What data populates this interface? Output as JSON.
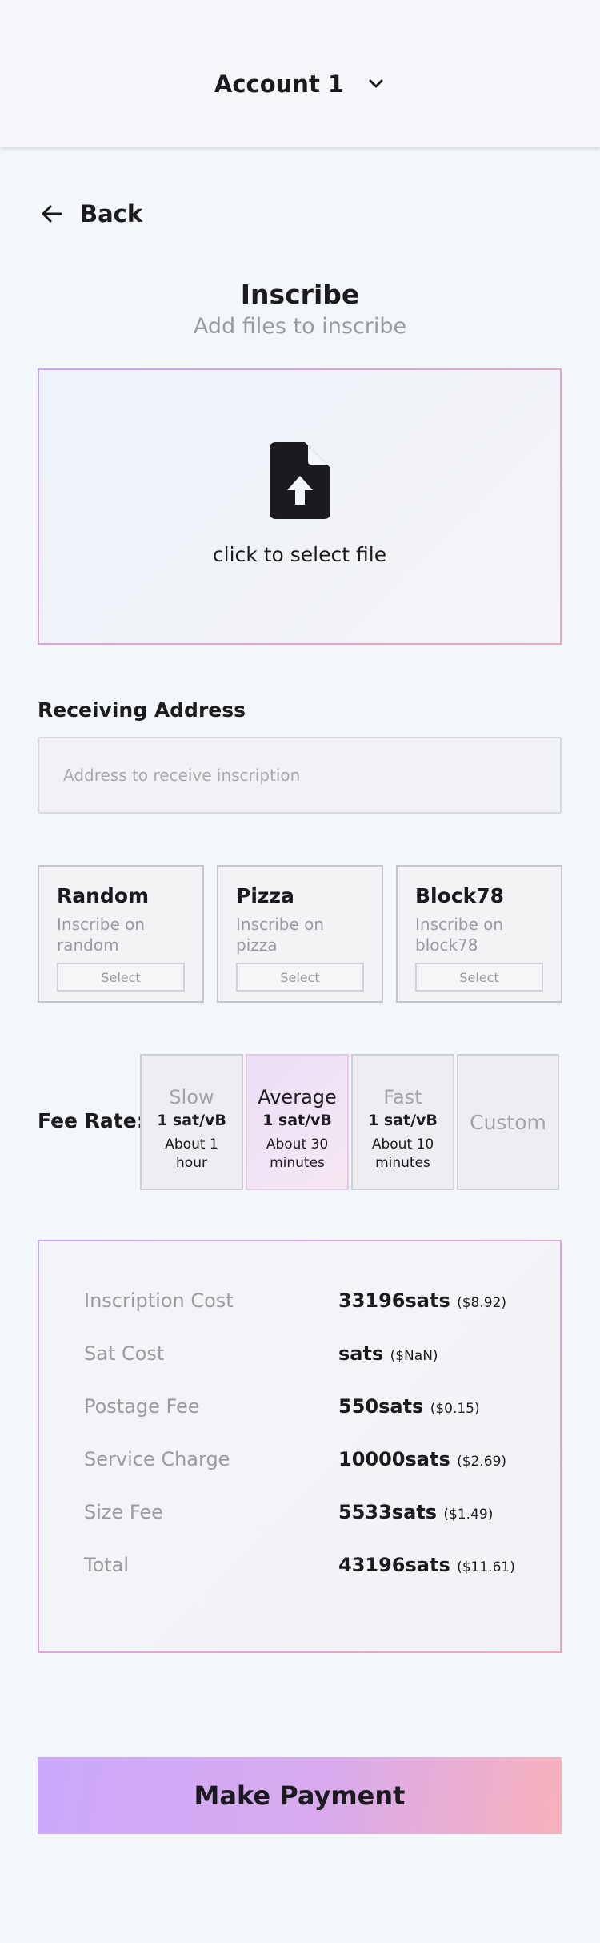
{
  "header": {
    "account_label": "Account 1",
    "account_icon": "chevron-down-icon"
  },
  "nav": {
    "back_label": "Back",
    "back_icon": "arrow-left-icon"
  },
  "page": {
    "title": "Inscribe",
    "subtitle": "Add files to inscribe"
  },
  "dropzone": {
    "label": "click to select file",
    "icon": "file-upload-icon"
  },
  "address": {
    "label": "Receiving Address",
    "placeholder": "Address to receive inscription",
    "value": ""
  },
  "sat_options": [
    {
      "title": "Random",
      "desc": "Inscribe on random",
      "button": "Select"
    },
    {
      "title": "Pizza",
      "desc": "Inscribe on pizza",
      "button": "Select"
    },
    {
      "title": "Block78",
      "desc": "Inscribe on block78",
      "button": "Select"
    }
  ],
  "fee": {
    "label": "Fee Rate:",
    "options": [
      {
        "name": "Slow",
        "rate": "1 sat/vB",
        "time": "About 1 hour",
        "active": false
      },
      {
        "name": "Average",
        "rate": "1 sat/vB",
        "time": "About 30 minutes",
        "active": true
      },
      {
        "name": "Fast",
        "rate": "1 sat/vB",
        "time": "About 10 minutes",
        "active": false
      }
    ],
    "custom_label": "Custom"
  },
  "summary": {
    "rows": [
      {
        "key": "Inscription Cost",
        "value": "33196sats",
        "usd": "($8.92)"
      },
      {
        "key": "Sat Cost",
        "value": "sats",
        "usd": "($NaN)"
      },
      {
        "key": "Postage Fee",
        "value": "550sats",
        "usd": "($0.15)"
      },
      {
        "key": "Service Charge",
        "value": "10000sats",
        "usd": "($2.69)"
      },
      {
        "key": "Size Fee",
        "value": "5533sats",
        "usd": "($1.49)"
      },
      {
        "key": "Total",
        "value": "43196sats",
        "usd": "($11.61)"
      }
    ]
  },
  "actions": {
    "pay_label": "Make Payment"
  },
  "colors": {
    "background": "#f3f6fb",
    "accent_start": "#cca8fb",
    "accent_end": "#f7b2bb",
    "text": "#1b1a1f",
    "muted": "#9a9aa0"
  }
}
